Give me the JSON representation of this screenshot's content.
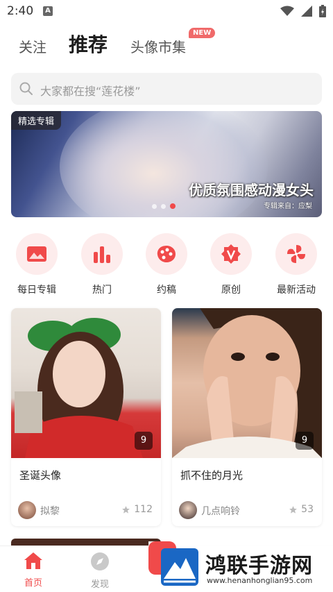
{
  "status": {
    "time": "2:40",
    "sim": "A"
  },
  "topnav": {
    "tabs": [
      {
        "label": "关注"
      },
      {
        "label": "推荐"
      },
      {
        "label": "头像市集"
      }
    ],
    "new_badge": "NEW"
  },
  "search": {
    "placeholder": "大家都在搜“莲花楼”"
  },
  "banner": {
    "badge": "精选专辑",
    "title": "优质氛围感动漫女头",
    "source": "专辑来自：应梨",
    "dots": 3,
    "active_dot": 3
  },
  "categories": [
    {
      "label": "每日专辑",
      "icon": "picture-icon"
    },
    {
      "label": "热门",
      "icon": "bar-chart-icon"
    },
    {
      "label": "约稿",
      "icon": "palette-icon"
    },
    {
      "label": "原创",
      "icon": "original-v-icon"
    },
    {
      "label": "最新活动",
      "icon": "pinwheel-icon"
    }
  ],
  "cards": [
    {
      "title": "圣诞头像",
      "count": "9",
      "author": "拟黎",
      "likes": "112"
    },
    {
      "title": "抓不住的月光",
      "count": "9",
      "author": "几点响铃",
      "likes": "53"
    }
  ],
  "tabbar": [
    {
      "label": "首页",
      "icon": "home-icon",
      "active": true
    },
    {
      "label": "发现",
      "icon": "compass-icon",
      "active": false
    }
  ],
  "watermark": {
    "title": "鸿联手游网",
    "url": "www.henanhonglian95.com"
  },
  "colors": {
    "accent": "#f04a4a",
    "icon_bg": "#fdecec",
    "text_muted": "#999999"
  }
}
